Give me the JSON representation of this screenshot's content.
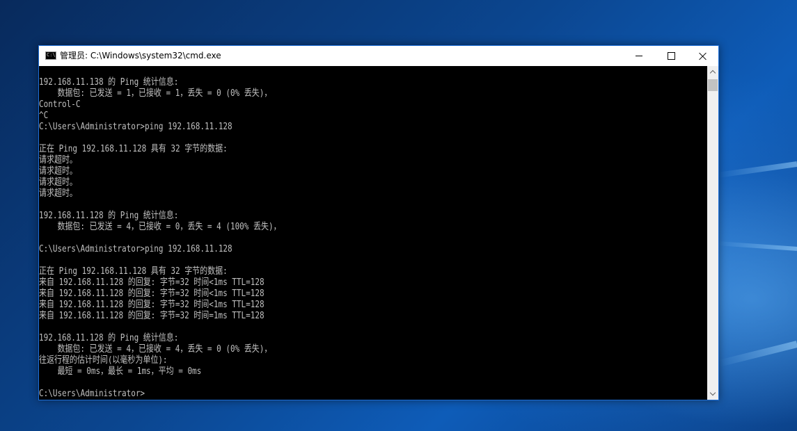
{
  "window": {
    "title": "管理员: C:\\Windows\\system32\\cmd.exe",
    "icon_text": "C:\\"
  },
  "console": {
    "lines": [
      "192.168.11.138 的 Ping 统计信息:",
      "    数据包: 已发送 = 1，已接收 = 1，丢失 = 0 (0% 丢失)，",
      "Control-C",
      "^C",
      "C:\\Users\\Administrator>ping 192.168.11.128",
      "",
      "正在 Ping 192.168.11.128 具有 32 字节的数据:",
      "请求超时。",
      "请求超时。",
      "请求超时。",
      "请求超时。",
      "",
      "192.168.11.128 的 Ping 统计信息:",
      "    数据包: 已发送 = 4，已接收 = 0，丢失 = 4 (100% 丢失)，",
      "",
      "C:\\Users\\Administrator>ping 192.168.11.128",
      "",
      "正在 Ping 192.168.11.128 具有 32 字节的数据:",
      "来自 192.168.11.128 的回复: 字节=32 时间<1ms TTL=128",
      "来自 192.168.11.128 的回复: 字节=32 时间<1ms TTL=128",
      "来自 192.168.11.128 的回复: 字节=32 时间<1ms TTL=128",
      "来自 192.168.11.128 的回复: 字节=32 时间=1ms TTL=128",
      "",
      "192.168.11.128 的 Ping 统计信息:",
      "    数据包: 已发送 = 4，已接收 = 4，丢失 = 0 (0% 丢失)，",
      "往返行程的估计时间(以毫秒为单位):",
      "    最短 = 0ms，最长 = 1ms，平均 = 0ms",
      "",
      "C:\\Users\\Administrator>"
    ]
  },
  "icons": {
    "app": "cmd-app-icon",
    "minimize": "minimize-icon",
    "maximize": "maximize-icon",
    "close": "close-icon",
    "scroll_up": "chevron-up-icon",
    "scroll_down": "chevron-down-icon"
  },
  "colors": {
    "console_background": "#000000",
    "console_text": "#c0c0c0",
    "title_bar": "#ffffff",
    "window_border": "#1e6fd9"
  }
}
